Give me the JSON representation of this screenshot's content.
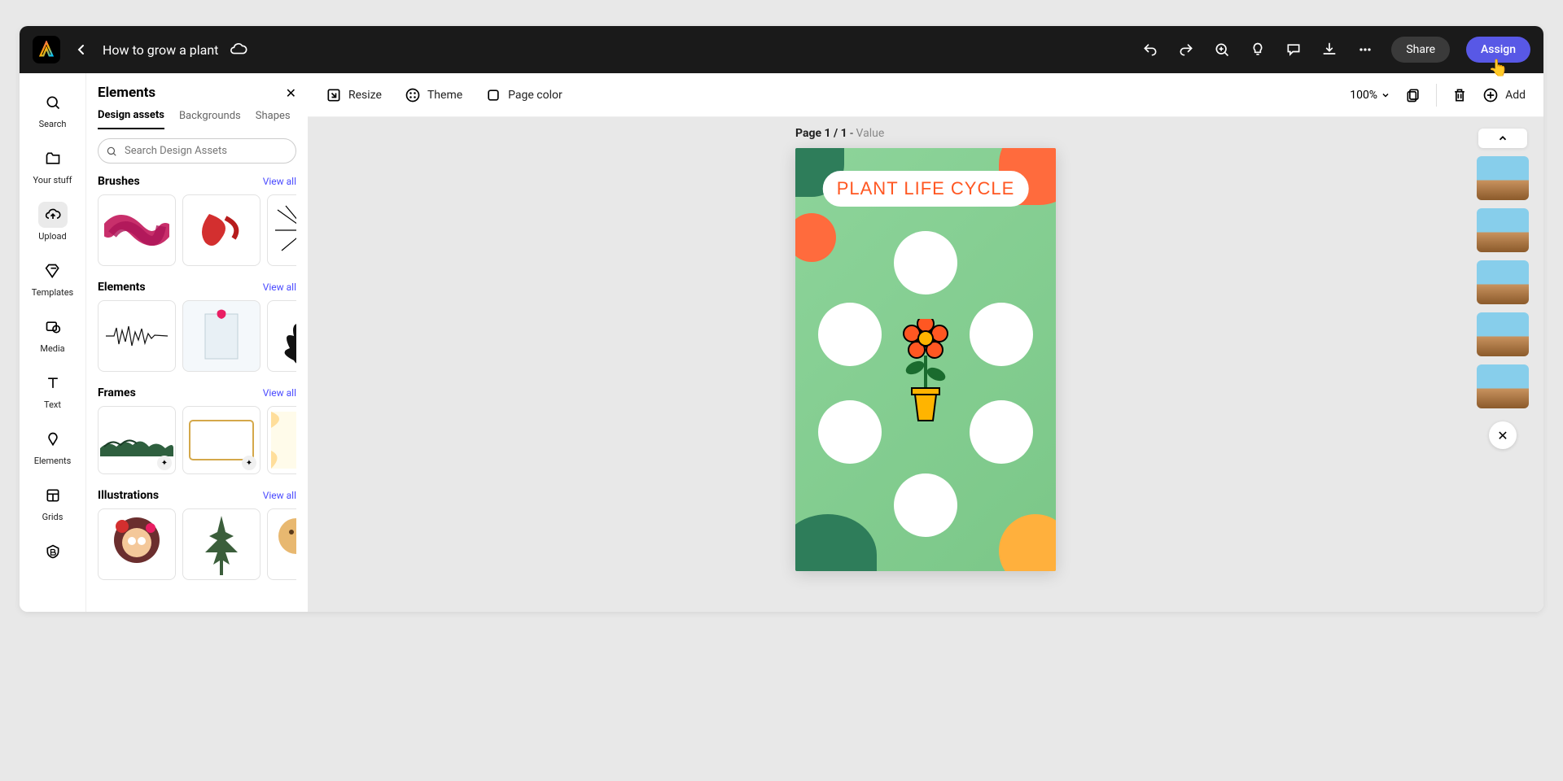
{
  "header": {
    "title": "How to grow a plant",
    "share_label": "Share",
    "assign_label": "Assign"
  },
  "rail": {
    "items": [
      {
        "label": "Search"
      },
      {
        "label": "Your stuff"
      },
      {
        "label": "Upload"
      },
      {
        "label": "Templates"
      },
      {
        "label": "Media"
      },
      {
        "label": "Text"
      },
      {
        "label": "Elements"
      },
      {
        "label": "Grids"
      }
    ]
  },
  "panel": {
    "title": "Elements",
    "tabs": [
      "Design assets",
      "Backgrounds",
      "Shapes"
    ],
    "active_tab": 0,
    "search_placeholder": "Search Design Assets",
    "view_all_label": "View all",
    "sections": [
      {
        "title": "Brushes"
      },
      {
        "title": "Elements"
      },
      {
        "title": "Frames"
      },
      {
        "title": "Illustrations"
      }
    ]
  },
  "ribbon": {
    "resize": "Resize",
    "theme": "Theme",
    "page_color": "Page color",
    "zoom": "100%",
    "add": "Add"
  },
  "canvas": {
    "page_label_prefix": "Page 1 / 1",
    "page_label_suffix": " - ",
    "page_label_value": "Value",
    "artwork_title": "PLANT LIFE CYCLE"
  },
  "pages_strip": {
    "count": 5
  }
}
